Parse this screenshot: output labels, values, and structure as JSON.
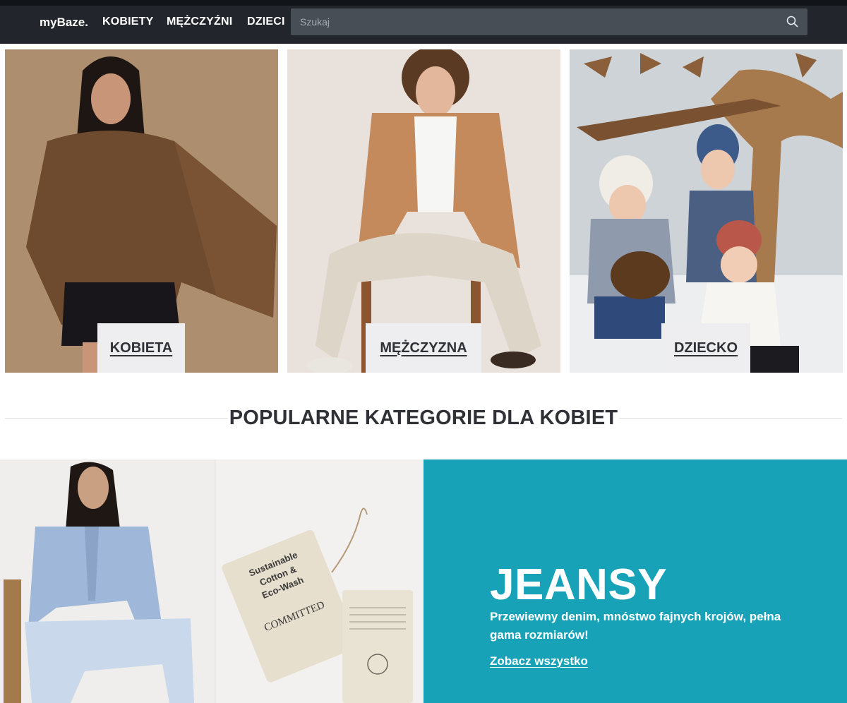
{
  "navbar": {
    "brand": "myBaze.",
    "links": [
      "KOBIETY",
      "MĘŻCZYŹNI",
      "DZIECI"
    ],
    "search": {
      "placeholder": "Szukaj",
      "value": "",
      "icon": "search-icon"
    }
  },
  "categories": [
    {
      "label": "KOBIETA"
    },
    {
      "label": "MĘŻCZYZNA"
    },
    {
      "label": "DZIECKO"
    }
  ],
  "section": {
    "title": "POPULARNE KATEGORIE DLA KOBIET"
  },
  "promo": {
    "title": "JEANSY",
    "description": "Przewiewny denim, mnóstwo fajnych krojów, pełna gama rozmiarów!",
    "link": "Zobacz wszystko",
    "tag_text": "Sustainable Cotton & Eco-Wash",
    "tag_brand": "COMMITTED",
    "background_color": "#17a2b8"
  },
  "colors": {
    "navbar": "#22262c",
    "search": "#484e56",
    "label_bg": "#eeeef0"
  }
}
